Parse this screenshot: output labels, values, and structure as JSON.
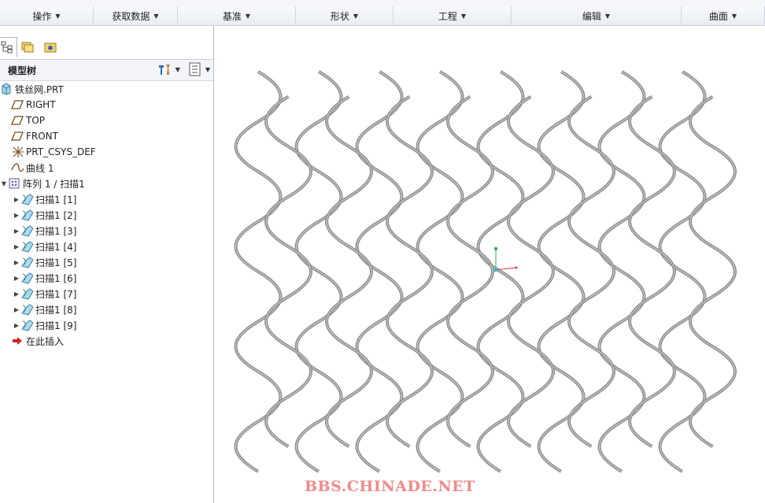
{
  "ribbon": {
    "groups": [
      {
        "label": "操作",
        "width": 119
      },
      {
        "label": "获取数据",
        "width": 107
      },
      {
        "label": "基准",
        "width": 150
      },
      {
        "label": "形状",
        "width": 124
      },
      {
        "label": "工程",
        "width": 150
      },
      {
        "label": "编辑",
        "width": 216
      },
      {
        "label": "曲面",
        "width": 106
      }
    ]
  },
  "model_tree": {
    "title": "模型树",
    "items": [
      {
        "label": "铁丝网.PRT",
        "icon": "part-icon",
        "indent": 0,
        "expander": ""
      },
      {
        "label": "RIGHT",
        "icon": "datum-plane-icon",
        "indent": 1,
        "expander": ""
      },
      {
        "label": "TOP",
        "icon": "datum-plane-icon",
        "indent": 1,
        "expander": ""
      },
      {
        "label": "FRONT",
        "icon": "datum-plane-icon",
        "indent": 1,
        "expander": ""
      },
      {
        "label": "PRT_CSYS_DEF",
        "icon": "csys-icon",
        "indent": 1,
        "expander": ""
      },
      {
        "label": "曲线 1",
        "icon": "curve-icon",
        "indent": 1,
        "expander": ""
      },
      {
        "label": "阵列 1 / 扫描1",
        "icon": "pattern-icon",
        "indent": 0,
        "expander": "▼"
      },
      {
        "label": "扫描1 [1]",
        "icon": "sweep-icon",
        "indent": 2,
        "expander": "▶"
      },
      {
        "label": "扫描1 [2]",
        "icon": "sweep-icon",
        "indent": 2,
        "expander": "▶"
      },
      {
        "label": "扫描1 [3]",
        "icon": "sweep-icon",
        "indent": 2,
        "expander": "▶"
      },
      {
        "label": "扫描1 [4]",
        "icon": "sweep-icon",
        "indent": 2,
        "expander": "▶"
      },
      {
        "label": "扫描1 [5]",
        "icon": "sweep-icon",
        "indent": 2,
        "expander": "▶"
      },
      {
        "label": "扫描1 [6]",
        "icon": "sweep-icon",
        "indent": 2,
        "expander": "▶"
      },
      {
        "label": "扫描1 [7]",
        "icon": "sweep-icon",
        "indent": 2,
        "expander": "▶"
      },
      {
        "label": "扫描1 [8]",
        "icon": "sweep-icon",
        "indent": 2,
        "expander": "▶"
      },
      {
        "label": "扫描1 [9]",
        "icon": "sweep-icon",
        "indent": 2,
        "expander": "▶"
      },
      {
        "label": "在此插入",
        "icon": "insert-here-icon",
        "indent": 1,
        "expander": ""
      }
    ]
  },
  "viewport": {
    "watermark": "BBS.CHINADE.NET",
    "mesh_color": "#8a8a8a",
    "watermark_color": "#f08a8a"
  }
}
